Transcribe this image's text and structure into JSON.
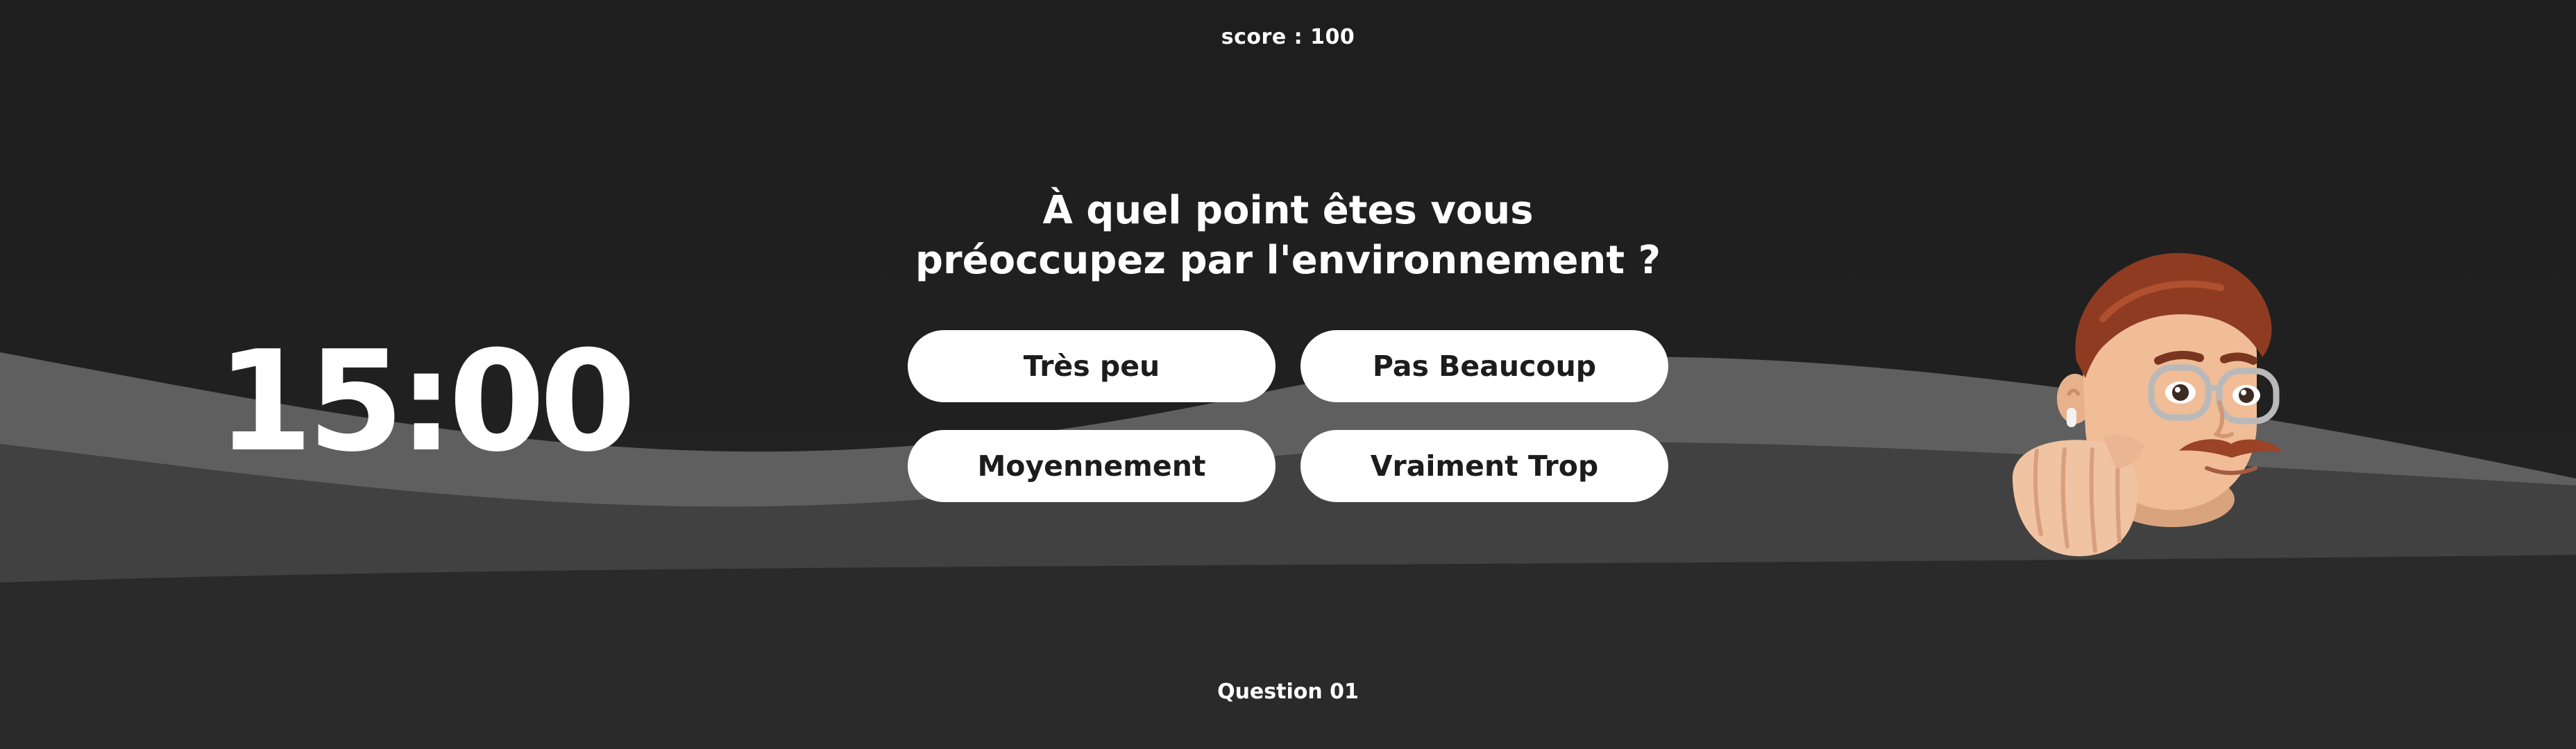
{
  "score": {
    "label": "score : 100"
  },
  "question": {
    "line1": "À quel point êtes vous",
    "line2": "préoccupez par l'environnement ?",
    "number": "Question 01"
  },
  "timer": {
    "value": "15:00"
  },
  "answers": [
    {
      "label": "Très peu"
    },
    {
      "label": "Pas Beaucoup"
    },
    {
      "label": "Moyennement"
    },
    {
      "label": "Vraiment Trop"
    }
  ],
  "colors": {
    "background": "#1f1f1f",
    "wave_light": "#5f5f5f",
    "wave_dark": "#414141",
    "button": "#ffffff",
    "button_text": "#1c1c1c",
    "text": "#ffffff"
  },
  "avatar": {
    "icon": "memoji-avatar-icon"
  }
}
